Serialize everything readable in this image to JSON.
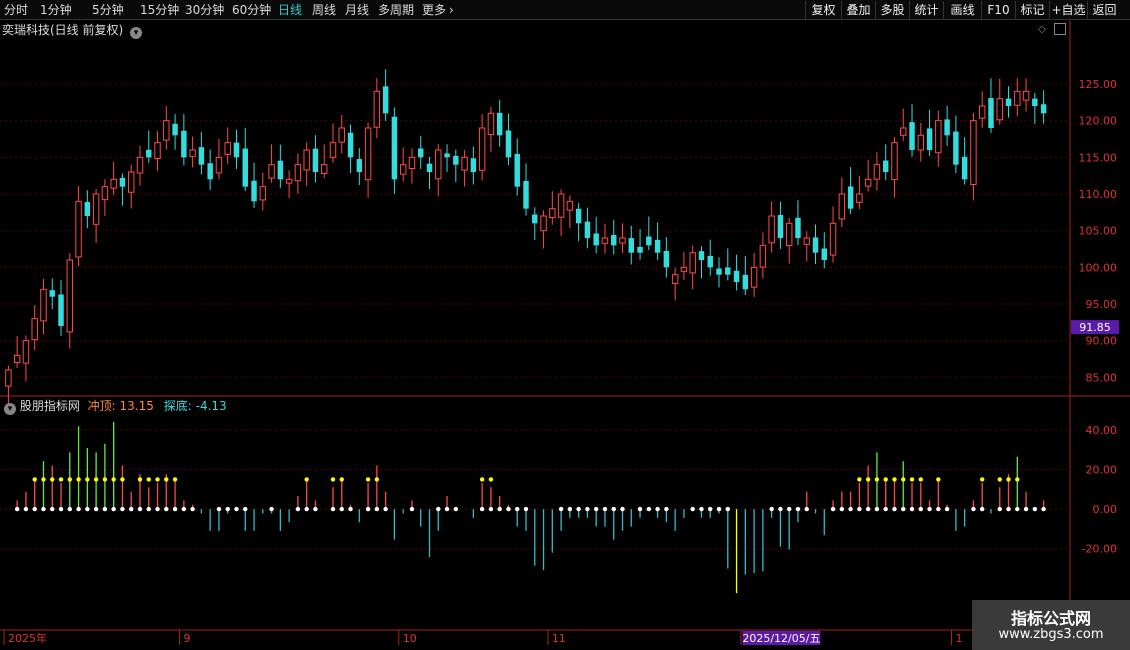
{
  "toolbar": {
    "period_tabs": [
      "分时",
      "1分钟",
      "5分钟",
      "15分钟",
      "30分钟",
      "60分钟",
      "日线",
      "周线",
      "月线",
      "多周期",
      "更多"
    ],
    "active_tab": "日线",
    "more_arrow": "›",
    "right_buttons": [
      "复权",
      "叠加",
      "多股",
      "统计",
      "画线",
      "F10",
      "标记",
      "+自选",
      "返回"
    ]
  },
  "stock_title": "奕瑞科技(日线 前复权)",
  "indicator": {
    "name": "股朋指标网",
    "label1": "冲顶:",
    "value1": "13.15",
    "label2": "探底:",
    "value2": "-4.13"
  },
  "current_price_tag": "91.85",
  "cursor_date": "2025/12/05/五",
  "month_labels": [
    {
      "label": "2025年",
      "index": 0
    },
    {
      "label": "9",
      "index": 20
    },
    {
      "label": "10",
      "index": 45
    },
    {
      "label": "11",
      "index": 62
    },
    {
      "label": "12",
      "index": 84
    },
    {
      "label": "1",
      "index": 108
    }
  ],
  "watermark": {
    "line1": "指标公式网",
    "line2": "www.zbgs3.com"
  },
  "colors": {
    "up": "#ff4a4a",
    "down": "#33dddd",
    "yellow": "#ffff00",
    "green": "#66ee33",
    "grid": "#5a0000"
  },
  "chart_data": {
    "type": "candlestick",
    "price_ticks": [
      125.0,
      120.0,
      115.0,
      110.0,
      105.0,
      100.0,
      95.0,
      90.0,
      85.0
    ],
    "price_range": [
      83.0,
      131.0
    ],
    "indicator_ticks": [
      40.0,
      20.0,
      0.0,
      -20.0
    ],
    "indicator_range": [
      -60,
      48
    ],
    "closes": [
      86,
      88,
      90,
      93,
      97,
      96,
      92,
      101,
      109,
      107,
      110,
      111,
      112,
      111,
      113,
      115,
      115,
      117,
      120,
      118,
      115,
      116,
      114,
      112,
      115,
      117,
      115,
      111,
      109,
      111,
      114,
      112,
      112,
      114,
      116,
      113,
      114,
      117,
      119,
      115,
      113,
      119,
      124,
      121,
      112,
      114,
      115,
      115,
      113,
      116,
      115,
      114,
      115,
      113,
      119,
      121,
      118,
      115,
      111,
      108,
      106,
      107,
      108,
      110,
      109,
      106,
      104,
      103,
      104,
      103,
      104,
      102,
      102,
      103,
      102,
      100,
      99,
      100,
      102,
      101,
      100,
      99,
      99,
      98,
      97,
      100,
      103,
      107,
      104,
      106,
      104,
      104,
      102,
      101,
      106,
      110,
      108,
      110,
      112,
      114,
      113,
      117,
      119,
      116,
      118,
      116,
      120,
      118,
      114,
      112,
      120,
      122,
      119,
      123,
      122,
      124,
      124,
      122,
      121
    ]
  }
}
